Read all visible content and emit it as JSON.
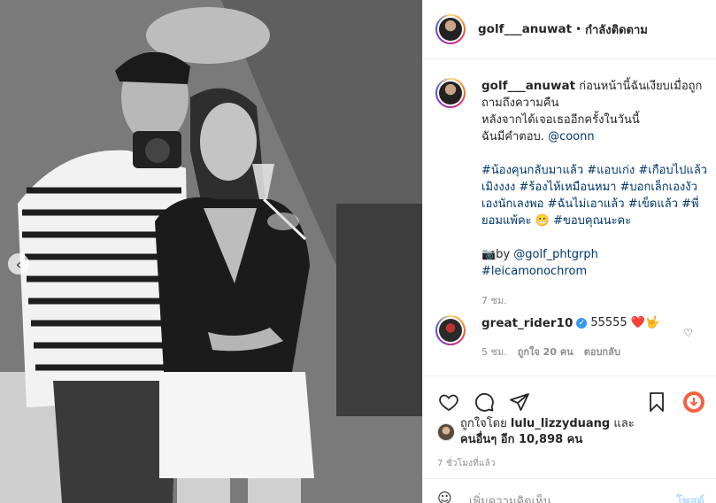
{
  "post": {
    "username": "golf___anuwat",
    "dot": "•",
    "follow_status": "กำลังติดตาม"
  },
  "caption": {
    "username": "golf___anuwat",
    "line1": "ก่อนหน้านี้ฉันเงียบเมื่อถูกถามถึงความคืน",
    "line2": "หลังจากได้เจอเธออีกครั้งในวันนี้",
    "line3_prefix": "ฉันมีคำตอบ. ",
    "mention": "@coonn",
    "hashtags": "#น้องคุนกลับมาแล้ว #แอบเก่ง #เกือบไปแล้วเมิงงงง #ร้องไห้เหมือนหมา #บอกเล็กเองงัวเองนักเลงพอ #ฉันไม่เอาแล้ว #เข็ดแล้ว #พี่ยอมแพ้คะ 😬 #ขอบคุณนะคะ",
    "credit_prefix": "📷by ",
    "credit_mention": "@golf_phtgrph",
    "credit_tag": "#leicamonochrom",
    "age": "7 ชม."
  },
  "comment": {
    "username": "great_rider10",
    "verified": "✓",
    "text": "55555 ❤️🤟",
    "age": "5 ชม.",
    "likes": "ถูกใจ 20 คน",
    "reply": "ตอบกลับ"
  },
  "likes": {
    "prefix": "ถูกใจโดย ",
    "user": "lulu_lizzyduang",
    "and": " และ",
    "others": "คนอื่นๆ อีก 10,898 คน"
  },
  "timestamp": "7 ชั่วโมงที่แล้ว",
  "add_comment": {
    "placeholder": "เพิ่มความคิดเห็น...",
    "post_label": "โพสต์"
  },
  "icons": {
    "prev": "chevron-left-icon",
    "like": "heart-icon",
    "comment": "comment-icon",
    "share": "send-icon",
    "save": "bookmark-icon",
    "emoji": "smile-icon"
  }
}
